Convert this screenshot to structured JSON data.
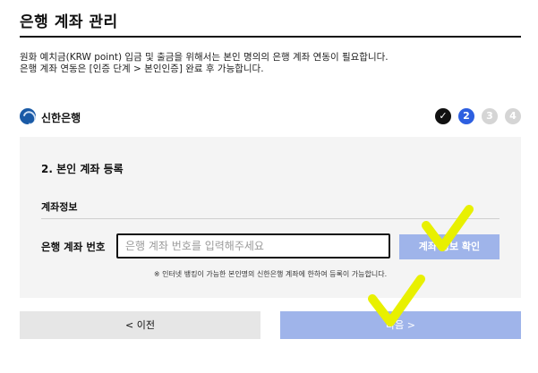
{
  "page": {
    "title": "은행 계좌 관리",
    "description_line1": "원화 예치금(KRW point) 입금 및 출금을 위해서는 본인 명의의 은행 계좌 연동이 필요합니다.",
    "description_line2": "은행 계좌 연동은 [인증 단계 > 본인인증] 완료 후 가능합니다."
  },
  "bank": {
    "name": "신한은행",
    "logo_icon": "shinhan-logo",
    "brand_color": "#1a5aa6"
  },
  "steps": [
    {
      "label": "✓",
      "state": "done"
    },
    {
      "label": "2",
      "state": "active"
    },
    {
      "label": "3",
      "state": "todo"
    },
    {
      "label": "4",
      "state": "todo"
    }
  ],
  "form": {
    "title": "2. 본인 계좌 등록",
    "section_label": "계좌정보",
    "account_label": "은행 계좌 번호",
    "account_value": "",
    "account_placeholder": "은행 계좌 번호를 입력해주세요",
    "verify_button": "계좌 정보 확인",
    "note": "※ 인터넷 뱅킹이 가능한 본인명의 신한은행 계좌에 한하여 등록이 가능합니다."
  },
  "nav": {
    "prev_label": "< 이전",
    "next_label": "다음 >"
  },
  "colors": {
    "accent": "#2d5fe0",
    "button_disabled": "#9fb4ea",
    "annotation": "#e8f000"
  }
}
